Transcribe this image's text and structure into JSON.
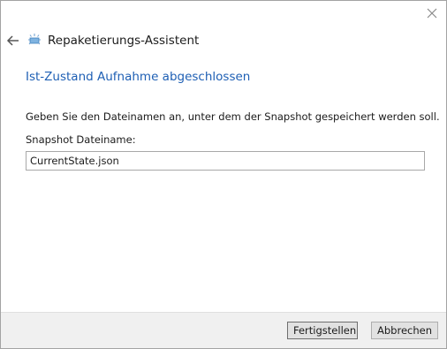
{
  "window": {
    "close_icon": "close-icon",
    "back_icon": "back-arrow-icon",
    "app_icon": "package-icon",
    "title": "Repaketierungs-Assistent"
  },
  "content": {
    "heading": "Ist-Zustand Aufnahme abgeschlossen",
    "description": "Geben Sie den Dateinamen an, unter dem der Snapshot gespeichert werden soll.",
    "field_label": "Snapshot Dateiname:",
    "field_value": "CurrentState.json"
  },
  "footer": {
    "finish_label": "Fertigstellen",
    "cancel_label": "Abbrechen"
  },
  "colors": {
    "heading": "#1e5fb4",
    "footer_bg": "#f0f0f0"
  }
}
